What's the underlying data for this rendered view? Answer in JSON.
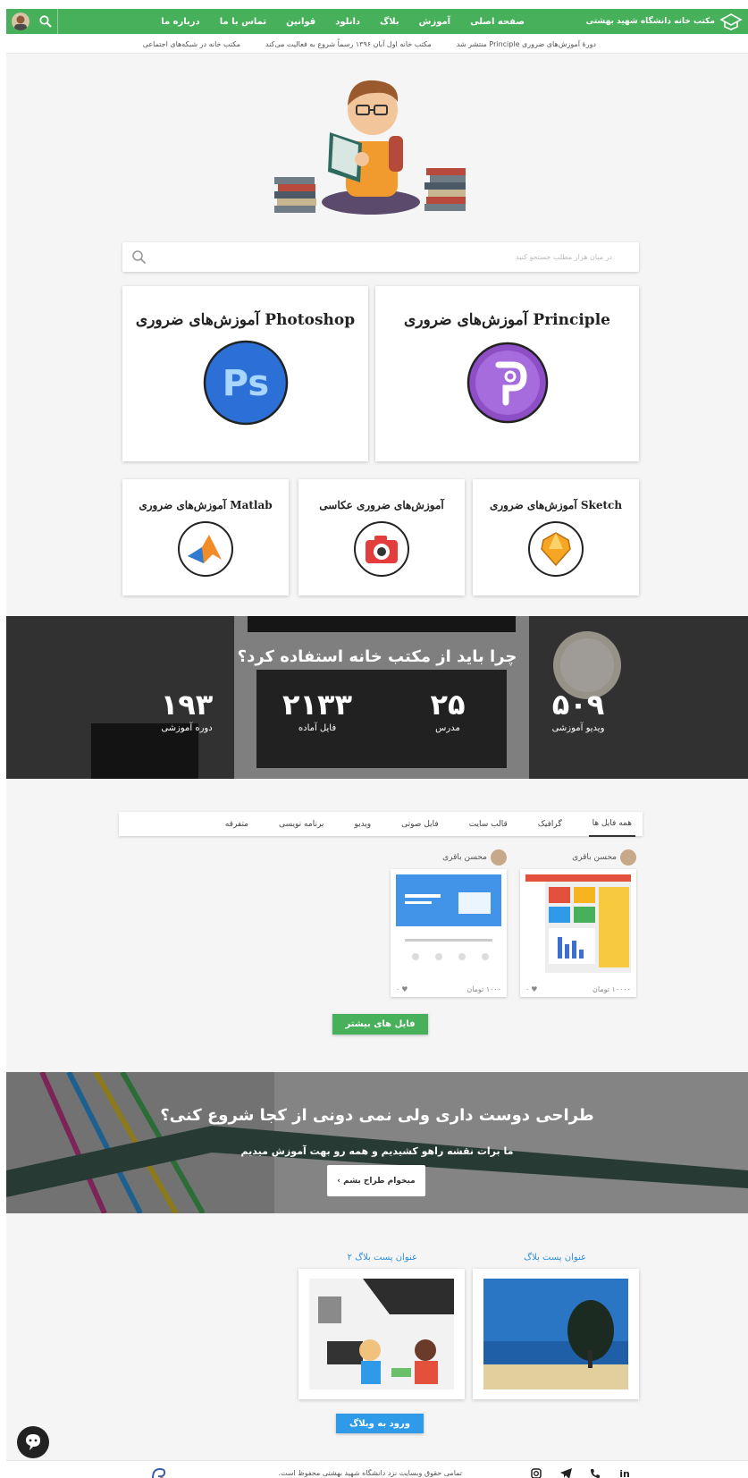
{
  "header": {
    "brand": "مکتب خانه دانشگاه شهید بهشتی",
    "nav": [
      "صفحه اصلی",
      "آموزش",
      "بلاگ",
      "دانلود",
      "قوانین",
      "تماس با ما",
      "درباره ما"
    ],
    "news": [
      "دورهٔ آموزش‌های ضروری Principle منتشر شد",
      "مکتب خانه اول آبان ۱۳۹۶ رسماً شروع به فعالیت می‌کند",
      "مکتب خانه در شبکه‌های اجتماعی"
    ]
  },
  "search": {
    "placeholder": "در میان هزار مطلب جستجو کنید"
  },
  "courses": {
    "principle": "آموزش‌های ضروری Principle",
    "photoshop": "آموزش‌های ضروری Photoshop",
    "sketch": "آموزش‌های ضروری Sketch",
    "photo": "آموزش‌های ضروری عکاسی",
    "matlab": "آموزش‌های ضروری Matlab"
  },
  "stats": {
    "title": "چرا باید از مکتب خانه استفاده کرد؟",
    "items": [
      {
        "num": "۵۰۹",
        "label": "ویدیو آموزشی"
      },
      {
        "num": "۲۵",
        "label": "مدرس"
      },
      {
        "num": "۲۱۳۳",
        "label": "فایل آماده"
      },
      {
        "num": "۱۹۳",
        "label": "دوره آموزشی"
      }
    ]
  },
  "files": {
    "tabs": [
      "همه فایل ها",
      "گرافیک",
      "قالب سایت",
      "فایل صوتی",
      "ویدیو",
      "برنامه نویسی",
      "متفرقه"
    ],
    "items": [
      {
        "author": "محسن باقری",
        "price": "۱۰۰۰۰ تومان",
        "likes": "۰"
      },
      {
        "author": "محسن باقری",
        "price": "۱۰۰۰ تومان",
        "likes": "۰"
      }
    ],
    "more_label": "فایل های بیشتر"
  },
  "cta": {
    "title": "طراحی دوست داری ولی نمی دونی از کجا شروع کنی؟",
    "subtitle": "ما برات نقشه راهو کشیدیم و همه رو بهت آموزش میدیم",
    "button": "میخوام طراح بشم ›"
  },
  "blog": {
    "posts": [
      {
        "title": "عنوان پست بلاگ"
      },
      {
        "title": "عنوان پست بلاگ ۲"
      }
    ],
    "enter_label": "ورود به وبلاگ"
  },
  "footer": {
    "copyright": "تمامی حقوق وبسایت نزد دانشگاه شهید بهشتی محفوظ است.",
    "socials": [
      "linkedin-icon",
      "phone-icon",
      "telegram-icon",
      "instagram-icon"
    ]
  },
  "colors": {
    "brand_green": "#47b05a",
    "link_blue": "#2f8fdb",
    "button_blue": "#2f9be8"
  }
}
